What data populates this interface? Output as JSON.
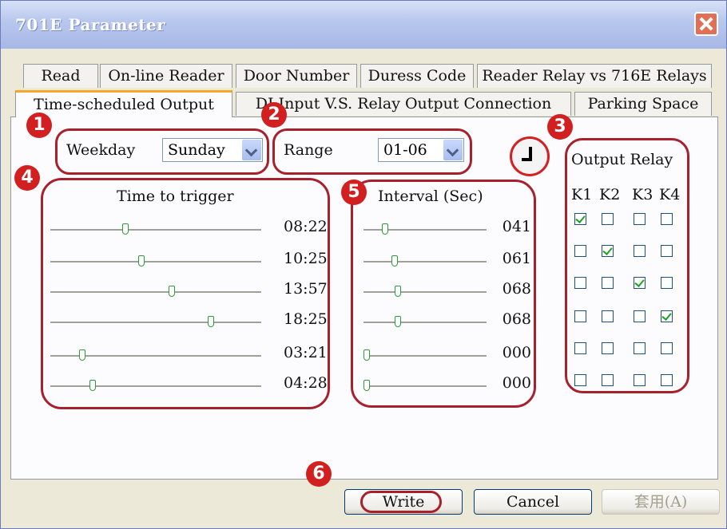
{
  "window": {
    "title": "701E Parameter"
  },
  "tabs_row1": [
    "Read",
    "On-line Reader",
    "Door Number",
    "Duress Code",
    "Reader Relay vs 716E Relays"
  ],
  "tabs_row2": [
    "Time-scheduled Output",
    "DI Input V.S. Relay Output Connection",
    "Parking Space"
  ],
  "weekday": {
    "label": "Weekday",
    "value": "Sunday"
  },
  "range": {
    "label": "Range",
    "value": "01-06"
  },
  "time_group": {
    "label": "Time to trigger",
    "rows": [
      {
        "value": "08:22",
        "level": 0.35
      },
      {
        "value": "10:25",
        "level": 0.43
      },
      {
        "value": "13:57",
        "level": 0.58
      },
      {
        "value": "18:25",
        "level": 0.77
      },
      {
        "value": "03:21",
        "level": 0.14
      },
      {
        "value": "04:28",
        "level": 0.19
      }
    ]
  },
  "interval_group": {
    "label": "Interval (Sec)",
    "rows": [
      {
        "value": "041",
        "level": 0.16
      },
      {
        "value": "061",
        "level": 0.24
      },
      {
        "value": "068",
        "level": 0.27
      },
      {
        "value": "068",
        "level": 0.27
      },
      {
        "value": "000",
        "level": 0.0
      },
      {
        "value": "000",
        "level": 0.0
      }
    ]
  },
  "output_relay": {
    "label": "Output Relay",
    "columns": [
      "K1",
      "K2",
      "K3",
      "K4"
    ],
    "rows": [
      [
        true,
        false,
        false,
        false
      ],
      [
        false,
        true,
        false,
        false
      ],
      [
        false,
        false,
        true,
        false
      ],
      [
        false,
        false,
        false,
        true
      ],
      [
        false,
        false,
        false,
        false
      ],
      [
        false,
        false,
        false,
        false
      ]
    ]
  },
  "annotations": [
    "1",
    "2",
    "3",
    "4",
    "5",
    "6"
  ],
  "buttons": {
    "write": "Write",
    "cancel": "Cancel",
    "apply": "套用(A)"
  },
  "colors": {
    "annotation": "#d21f1f",
    "accent_tab": "#f7a72a",
    "title_bar": "#a7b8e6"
  }
}
